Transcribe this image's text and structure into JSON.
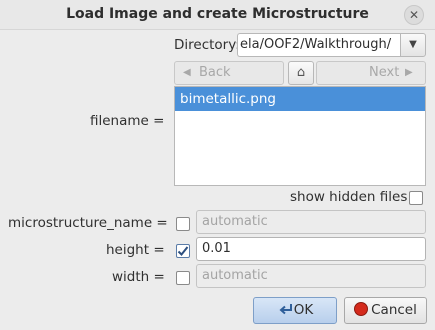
{
  "dialog": {
    "title": "Load Image and create Microstructure"
  },
  "directory": {
    "label": "Directory:",
    "value": "ela/OOF2/Walkthrough/",
    "back_label": "Back",
    "next_label": "Next",
    "back_arrow": "◀",
    "next_arrow": "▶",
    "dropdown_arrow": "▼",
    "home_glyph": "⌂"
  },
  "filename": {
    "label": "filename =",
    "files": [
      "bimetallic.png"
    ]
  },
  "show_hidden": {
    "label": "show hidden files",
    "checked": false
  },
  "params": [
    {
      "label": "microstructure_name =",
      "checked": false,
      "value": "automatic"
    },
    {
      "label": "height =",
      "checked": true,
      "value": "0.01"
    },
    {
      "label": "width =",
      "checked": false,
      "value": "automatic"
    }
  ],
  "buttons": {
    "ok_label": "OK",
    "cancel_label": "Cancel"
  },
  "icons": {
    "close": "close-icon",
    "ok": "ok-arrow-icon",
    "cancel": "stop-icon"
  },
  "colors": {
    "selection": "#4a90d9",
    "cancel_red": "#d42a1c"
  }
}
